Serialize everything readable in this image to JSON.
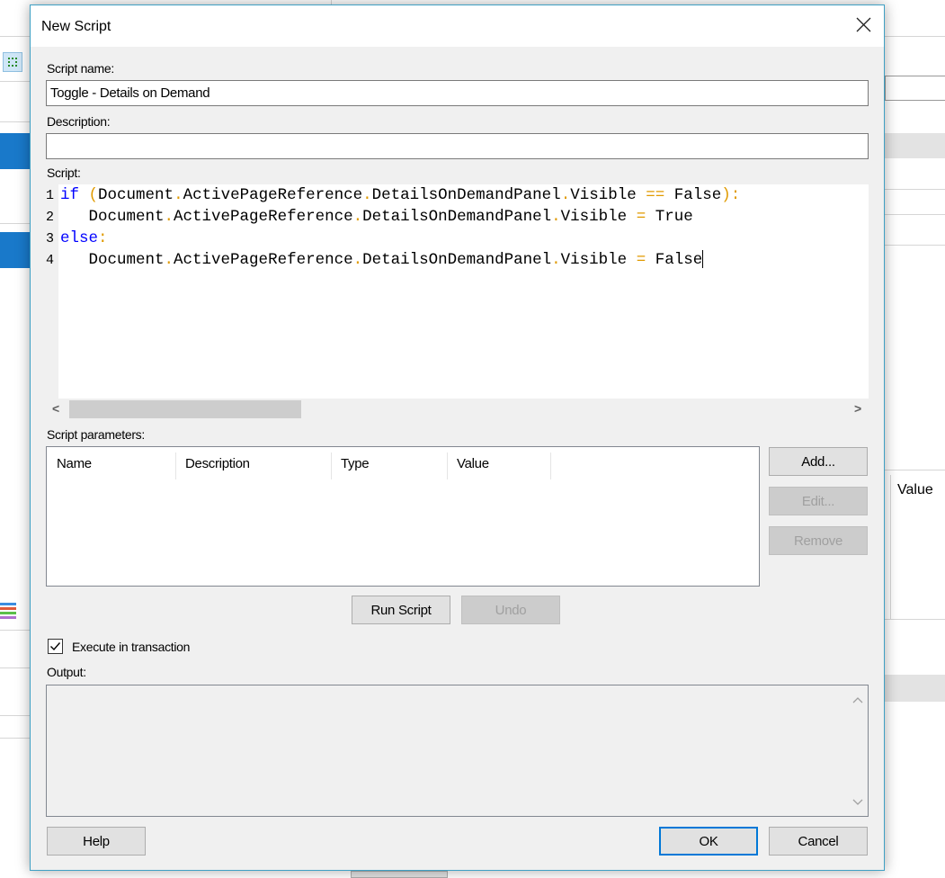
{
  "background": {
    "value_header": "Value"
  },
  "dialog": {
    "title": "New Script",
    "close_icon": "close-icon",
    "script_name_label": "Script name:",
    "script_name_value": "Toggle - Details on Demand",
    "description_label": "Description:",
    "description_value": "",
    "script_label": "Script:",
    "code_lines": [
      {
        "num": "1",
        "tokens": [
          {
            "t": "if",
            "c": "kw"
          },
          {
            "t": " ",
            "c": "id"
          },
          {
            "t": "(",
            "c": "op"
          },
          {
            "t": "Document",
            "c": "id"
          },
          {
            "t": ".",
            "c": "op"
          },
          {
            "t": "ActivePageReference",
            "c": "id"
          },
          {
            "t": ".",
            "c": "op"
          },
          {
            "t": "DetailsOnDemandPanel",
            "c": "id"
          },
          {
            "t": ".",
            "c": "op"
          },
          {
            "t": "Visible",
            "c": "id"
          },
          {
            "t": " == ",
            "c": "op"
          },
          {
            "t": "False",
            "c": "id"
          },
          {
            "t": "):",
            "c": "op"
          }
        ]
      },
      {
        "num": "2",
        "tokens": [
          {
            "t": "   Document",
            "c": "id"
          },
          {
            "t": ".",
            "c": "op"
          },
          {
            "t": "ActivePageReference",
            "c": "id"
          },
          {
            "t": ".",
            "c": "op"
          },
          {
            "t": "DetailsOnDemandPanel",
            "c": "id"
          },
          {
            "t": ".",
            "c": "op"
          },
          {
            "t": "Visible",
            "c": "id"
          },
          {
            "t": " = ",
            "c": "op"
          },
          {
            "t": "True",
            "c": "id"
          }
        ]
      },
      {
        "num": "3",
        "tokens": [
          {
            "t": "else",
            "c": "kw"
          },
          {
            "t": ":",
            "c": "op"
          }
        ]
      },
      {
        "num": "4",
        "tokens": [
          {
            "t": "   Document",
            "c": "id"
          },
          {
            "t": ".",
            "c": "op"
          },
          {
            "t": "ActivePageReference",
            "c": "id"
          },
          {
            "t": ".",
            "c": "op"
          },
          {
            "t": "DetailsOnDemandPanel",
            "c": "id"
          },
          {
            "t": ".",
            "c": "op"
          },
          {
            "t": "Visible",
            "c": "id"
          },
          {
            "t": " = ",
            "c": "op"
          },
          {
            "t": "False",
            "c": "id"
          }
        ]
      }
    ],
    "scroll_left": "<",
    "scroll_right": ">",
    "params_label": "Script parameters:",
    "params_columns": [
      "Name",
      "Description",
      "Type",
      "Value"
    ],
    "add_button": "Add...",
    "edit_button": "Edit...",
    "remove_button": "Remove",
    "run_button": "Run Script",
    "undo_button": "Undo",
    "execute_label": "Execute in transaction",
    "execute_checked": true,
    "output_label": "Output:",
    "help_button": "Help",
    "ok_button": "OK",
    "cancel_button": "Cancel"
  },
  "colors": {
    "keyword": "#0000ff",
    "operator": "#e09a00",
    "accent": "#0078d7"
  }
}
